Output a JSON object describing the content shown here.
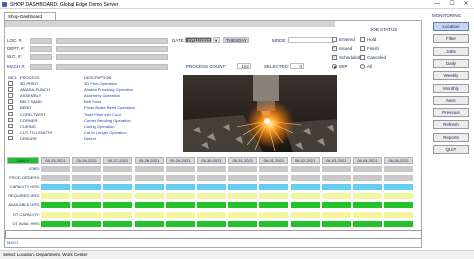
{
  "window": {
    "title": "SHOP DASHBOARD: Global Edge Demo Server",
    "controls": [
      "—",
      "☐",
      "✕"
    ]
  },
  "tab": "Shop-Dashboard",
  "location_fields": [
    {
      "label": "LOC. #:"
    },
    {
      "label": "DEPT. #:"
    },
    {
      "label": "W.C. #:"
    },
    {
      "label": "MACH #:"
    }
  ],
  "date": {
    "label": "DATE:",
    "value": "07/11/2023",
    "day": "TUESDAY"
  },
  "mode_label": "MODE:",
  "job_status": {
    "title": "JOB STATUS",
    "options": [
      {
        "label": "Entered",
        "checked": false
      },
      {
        "label": "Hold",
        "checked": false
      },
      {
        "label": "Issued",
        "checked": true
      },
      {
        "label": "Finish",
        "checked": false
      },
      {
        "label": "Scheduled",
        "checked": true
      },
      {
        "label": "Canceled",
        "checked": false
      }
    ],
    "scope": [
      {
        "label": "WIP",
        "selected": true
      },
      {
        "label": "All",
        "selected": false
      }
    ]
  },
  "process_count": {
    "label": "PROCESS COUNT:",
    "value": "162"
  },
  "selected": {
    "label": "SELECTED:",
    "value": "0"
  },
  "process_table": {
    "headers": {
      "incl": "INCL",
      "process": "PROCESS",
      "description": "DESCRIPTION"
    },
    "rows": [
      {
        "code": "3D-PRINT",
        "desc": "3D Print Operation"
      },
      {
        "code": "AMADA-PUNCH",
        "desc": "Amada Punching Operation"
      },
      {
        "code": "ASSEMBLY",
        "desc": "Assembly Operation"
      },
      {
        "code": "BELT SAND",
        "desc": "Belt Sand"
      },
      {
        "code": "BEND",
        "desc": "Press Brake Bend Operation"
      },
      {
        "code": "CORD-TWIST",
        "desc": "Twist Fiber into Cord"
      },
      {
        "code": "CORNER",
        "desc": "Corner Bending Operation"
      },
      {
        "code": "CURING",
        "desc": "Curing Operation"
      },
      {
        "code": "CUT-TO-LENGTH",
        "desc": "Cut to Length Operation"
      },
      {
        "code": "DEBURR",
        "desc": "Deburr"
      }
    ]
  },
  "sidebar": {
    "title": "MONITORING",
    "buttons": [
      {
        "label": "Location",
        "selected": true
      },
      {
        "label": "Filter",
        "selected": false
      },
      {
        "label": "Jobs",
        "selected": false
      },
      {
        "label": "Daily",
        "selected": false
      },
      {
        "label": "Weekly",
        "selected": false
      },
      {
        "label": "Monthly",
        "selected": false
      },
      {
        "label": "Next",
        "selected": false
      },
      {
        "label": "Previous",
        "selected": false
      },
      {
        "label": "Refresh",
        "selected": false
      },
      {
        "label": "Reports",
        "selected": false
      },
      {
        "label": "QUIT",
        "selected": false
      }
    ]
  },
  "schedule": {
    "period_label": "DAILY",
    "dates": [
      "05-23-2021",
      "05-26-2021",
      "05-27-2021",
      "05-28-2021",
      "05-29-2021",
      "05-30-2021",
      "05-31-2021",
      "06-01-2021",
      "06-02-2021",
      "06-03-2021",
      "06-04-2021",
      "06-05-2021"
    ],
    "rows": [
      {
        "label": "JOBS:",
        "color": "gray"
      },
      {
        "label": "PROD ORDERS:",
        "color": "gray"
      },
      {
        "label": "CAPACITY HRS:",
        "color": "blue"
      },
      {
        "label": "REQUIRED HRS:",
        "color": "yellow"
      },
      {
        "label": "AVAILABLE HRS:",
        "color": "green"
      },
      {
        "label": "OT CAPACITY:",
        "color": "yellow"
      },
      {
        "label": "OT AVAIL HRS:",
        "color": "green"
      }
    ]
  },
  "message": "MSG1",
  "status_bar": "Select Location, Department, Work Center",
  "colors": {
    "daily": "#20c030",
    "gray": "#c9c9c9",
    "blue": "#66ccf0",
    "yellow": "#f5f5a0",
    "green": "#22c22a"
  }
}
